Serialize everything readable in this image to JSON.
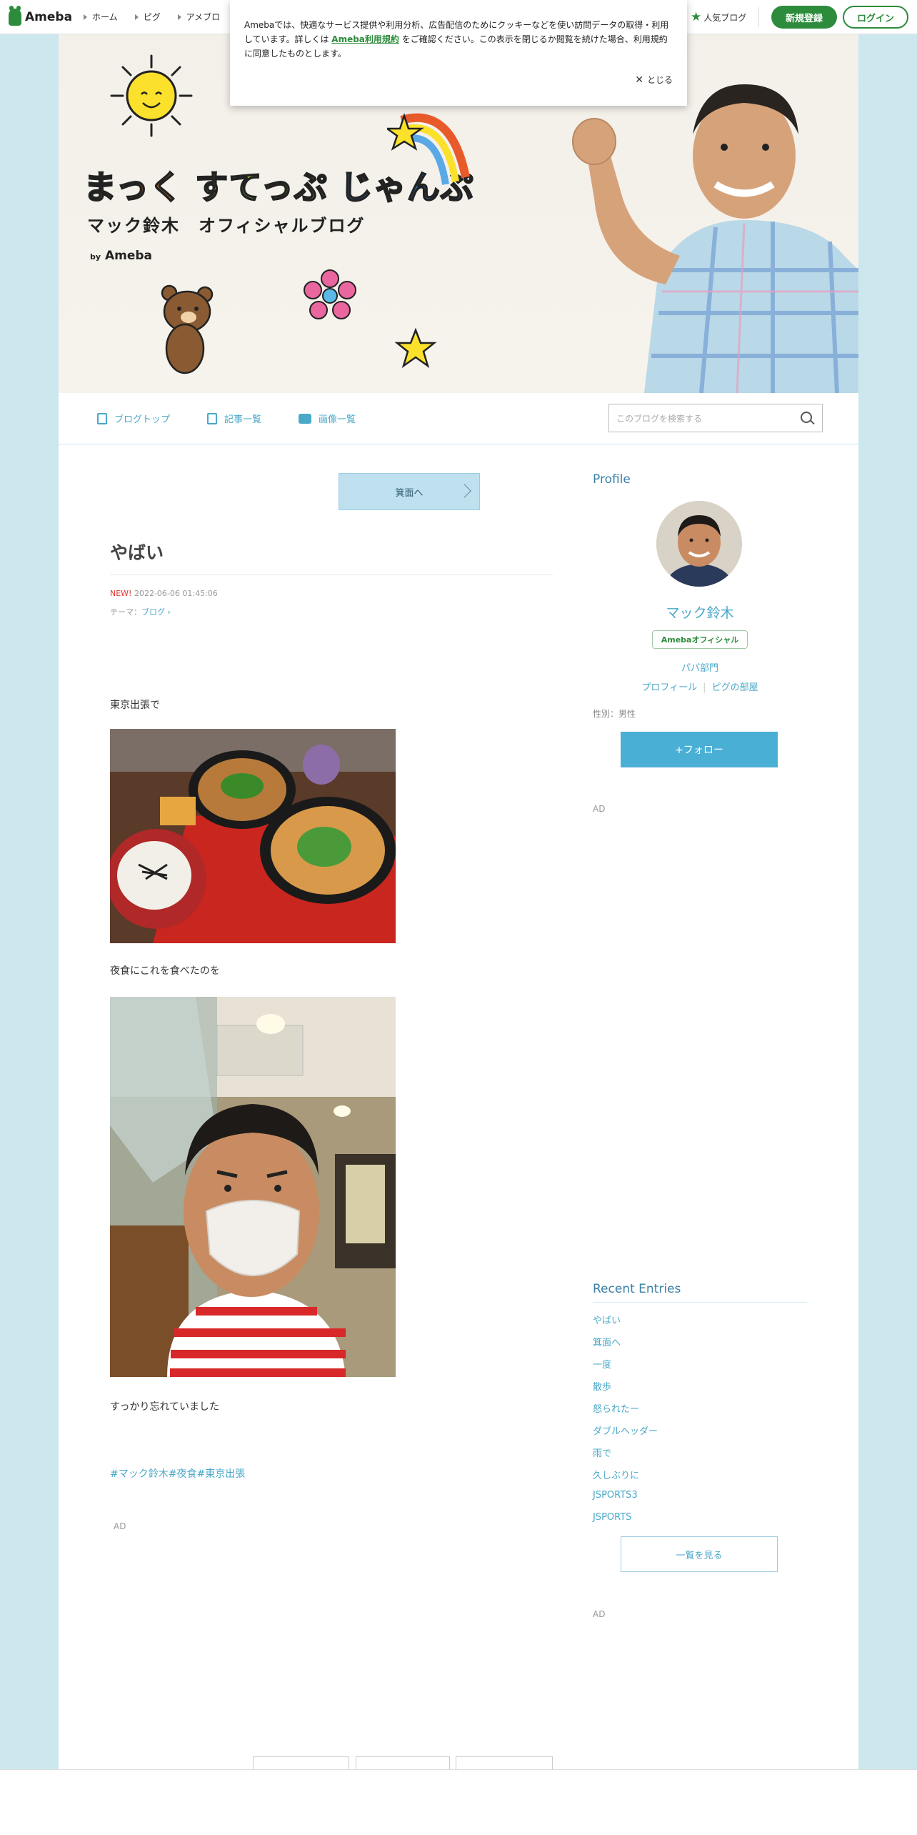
{
  "topbar": {
    "logo_text": "Ameba",
    "nav": [
      "ホーム",
      "ピグ",
      "アメブロ"
    ],
    "popular": "人気ブログ",
    "register": "新規登録",
    "login": "ログイン"
  },
  "cookie": {
    "text1": "Amebaでは、快適なサービス提供や利用分析、広告配信のためにクッキーなどを使い訪問データの取得・利用しています。詳しくは",
    "link": "Ameba利用規約",
    "text2": "をご確認ください。この表示を閉じるか閲覧を続けた場合、利用規約に同意したものとします。",
    "close": "とじる"
  },
  "header": {
    "title_part1": "まっく",
    "title_part2": "すてっぷ",
    "title_part3": "じゃんぷ",
    "subtitle": "マック鈴木　オフィシャルブログ",
    "by": "by",
    "by_brand": "Ameba"
  },
  "blognav": {
    "items": [
      "ブログトップ",
      "記事一覧",
      "画像一覧"
    ],
    "search_placeholder": "このブログを検索する"
  },
  "article": {
    "prev_button": "箕面へ",
    "title": "やばい",
    "new_label": "NEW!",
    "datetime": "2022-06-06 01:45:06",
    "theme_label": "テーマ：",
    "theme": "ブログ",
    "para1": "東京出張で",
    "para2": "夜食にこれを食べたのを",
    "para3": "すっかり忘れていました",
    "hashtags": [
      "#マック鈴木",
      "#夜食",
      "#東京出張"
    ],
    "ad": "AD"
  },
  "sidebar": {
    "profile_heading": "Profile",
    "name": "マック鈴木",
    "badge": "Amebaオフィシャル",
    "category": "パパ部門",
    "link_profile": "プロフィール",
    "link_room": "ピグの部屋",
    "gender": "性別：男性",
    "follow": "+フォロー",
    "ad1": "AD",
    "recent_heading": "Recent Entries",
    "recent": [
      "やばい",
      "箕面へ",
      "一度",
      "散歩",
      "怒られたー",
      "ダブルヘッダー",
      "雨で",
      "久しぶりに",
      "JSPORTS3",
      "JSPORTS"
    ],
    "see_all": "一覧を見る",
    "ad2": "AD"
  },
  "colors": {
    "ameba_green": "#2d8c3c",
    "link_blue": "#4aa8c8",
    "page_bg": "#cde7ef"
  }
}
